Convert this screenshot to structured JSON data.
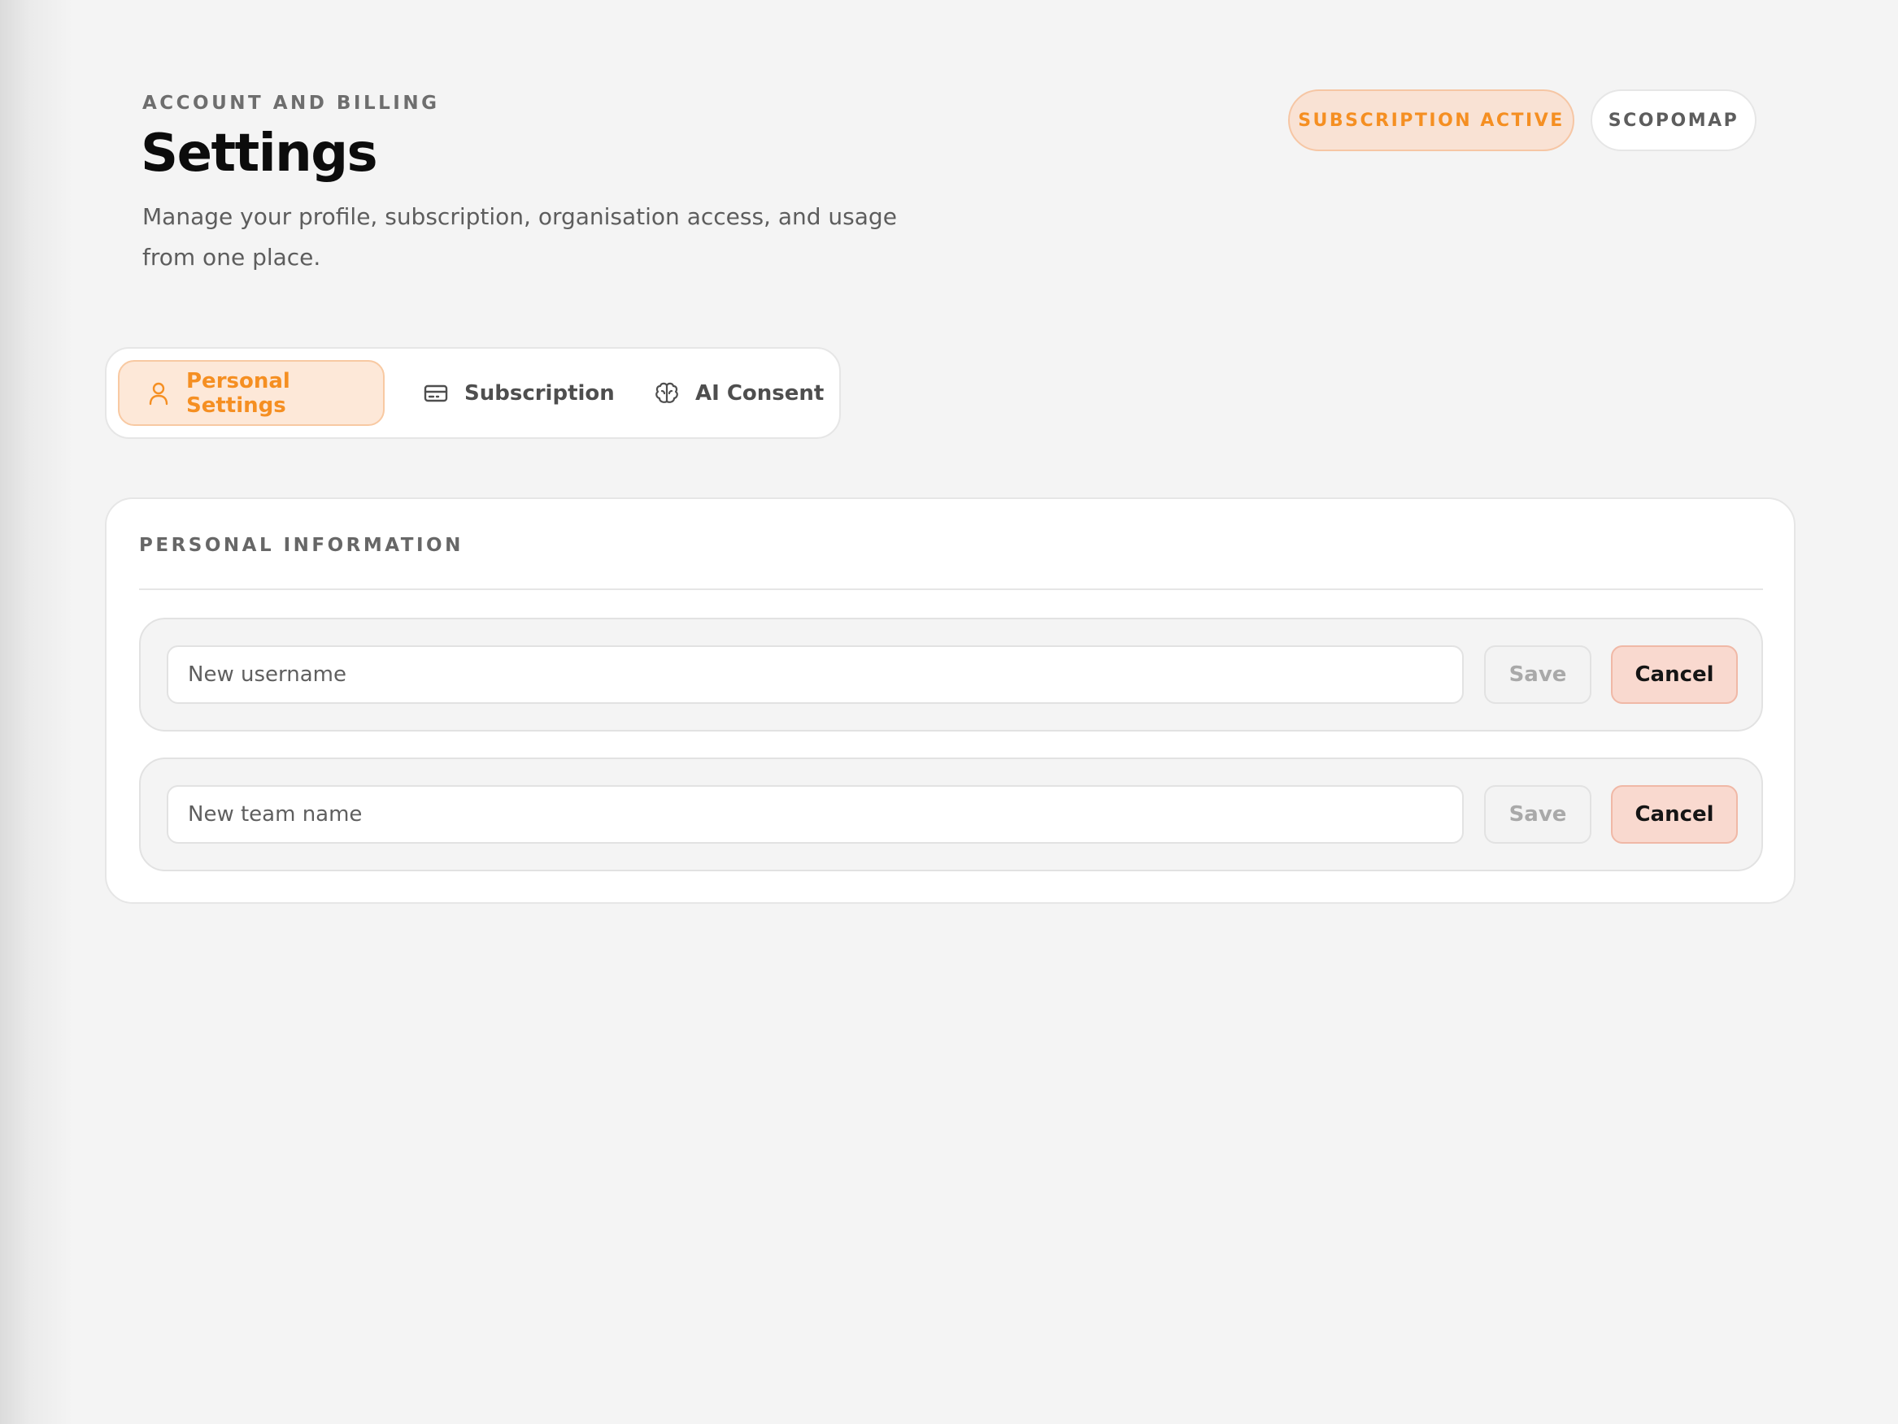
{
  "header": {
    "eyebrow": "ACCOUNT AND BILLING",
    "title": "Settings",
    "subtitle": "Manage your profile, subscription, organisation access, and usage from one place."
  },
  "badges": {
    "subscription_status": "SUBSCRIPTION ACTIVE",
    "organisation": "SCOPOMAP"
  },
  "tabs": [
    {
      "label": "Personal Settings",
      "icon": "user-icon",
      "active": true
    },
    {
      "label": "Subscription",
      "icon": "credit-card-icon",
      "active": false
    },
    {
      "label": "AI Consent",
      "icon": "brain-icon",
      "active": false
    }
  ],
  "personal_info": {
    "heading": "PERSONAL INFORMATION",
    "rows": [
      {
        "placeholder": "New username",
        "value": "",
        "save_label": "Save",
        "cancel_label": "Cancel"
      },
      {
        "placeholder": "New team name",
        "value": "",
        "save_label": "Save",
        "cancel_label": "Cancel"
      }
    ]
  },
  "colors": {
    "accent": "#f58f22",
    "accent_bg": "#fde8d8",
    "cancel_bg": "#f9d9cf",
    "page_bg": "#f4f4f4"
  }
}
